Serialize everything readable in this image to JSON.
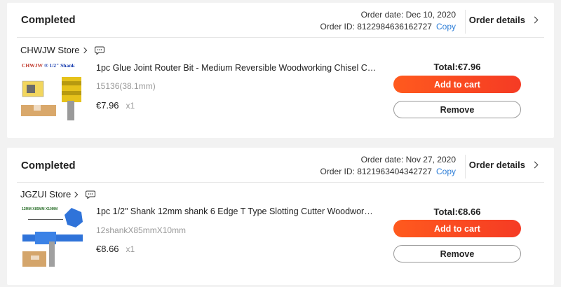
{
  "orders": [
    {
      "status": "Completed",
      "order_date": "Order date: Dec 10, 2020",
      "order_id": "Order ID: 8122984636162727",
      "copy_label": "Copy",
      "details_label": "Order details",
      "store": "CHWJW Store",
      "item": {
        "title": "1pc Glue Joint Router Bit - Medium Reversible Woodworking Chisel Cutter...",
        "variant": "15136(38.1mm)",
        "price": "€7.96",
        "qty": "x1",
        "image_text": "CHWJW® 1/2\" Shank"
      },
      "total": "Total:€7.96",
      "add_to_cart": "Add to cart",
      "remove": "Remove"
    },
    {
      "status": "Completed",
      "order_date": "Order date: Nov 27, 2020",
      "order_id": "Order ID: 8121963404342727",
      "copy_label": "Copy",
      "details_label": "Order details",
      "store": "JGZUI Store",
      "item": {
        "title": "1pc 1/2\" Shank 12mm shank 6 Edge T Type Slotting Cutter Woodworking...",
        "variant": "12shankX85mmX10mm",
        "price": "€8.66",
        "qty": "x1",
        "image_text": "12MM X85MM X10MM"
      },
      "total": "Total:€8.66",
      "add_to_cart": "Add to cart",
      "remove": "Remove"
    }
  ],
  "colors": {
    "accent": "#fb4c1f",
    "link": "#2f7fd8",
    "background": "#f2f2f2"
  },
  "icons": {
    "chat": "chat-bubble-icon",
    "chevron": "chevron-right-icon"
  }
}
